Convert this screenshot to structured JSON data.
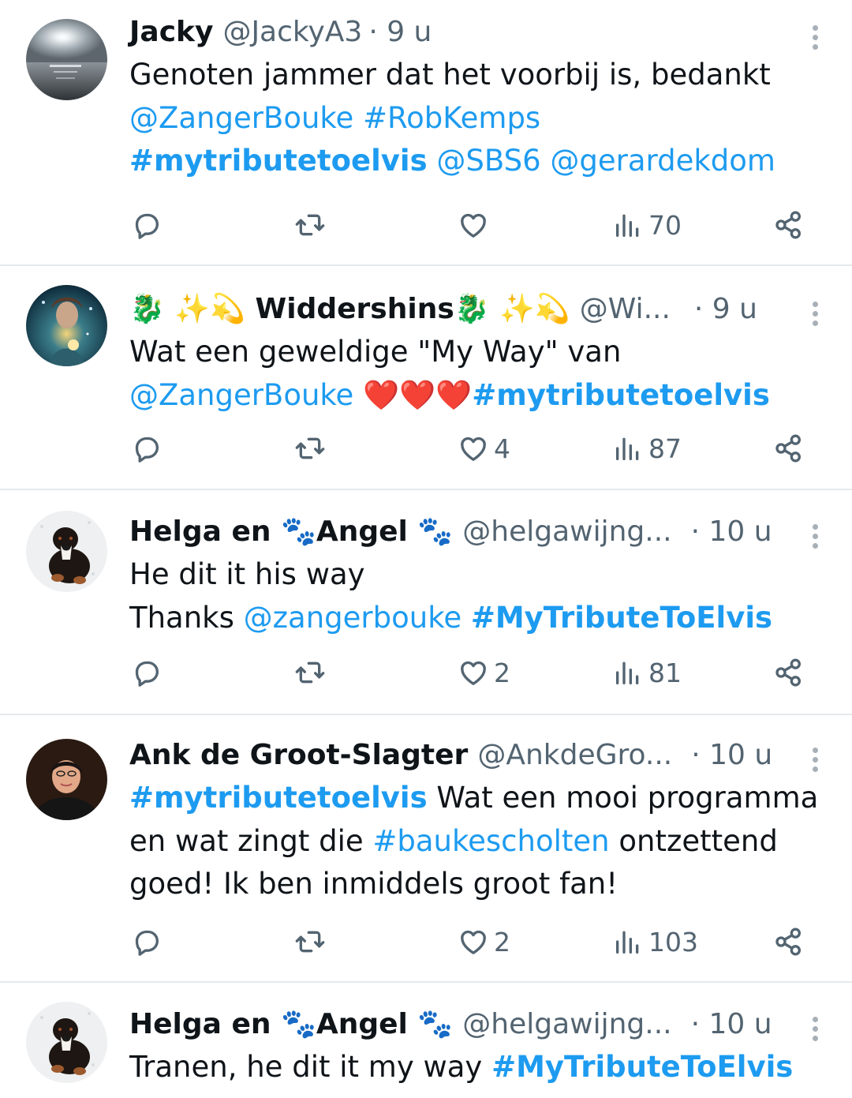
{
  "tweets": [
    {
      "name": "Jacky",
      "handle": "@JackyA3",
      "time": "· 9 u",
      "text_lines": [
        [
          {
            "t": "Genoten jammer dat het voorbij is, bedankt",
            "k": "plain"
          }
        ],
        [
          {
            "t": "@ZangerBouke",
            "k": "link"
          },
          {
            "t": " ",
            "k": "plain"
          },
          {
            "t": "#RobKemps",
            "k": "link"
          }
        ],
        [
          {
            "t": "#mytributetoelvis",
            "k": "linkbold"
          },
          {
            "t": " ",
            "k": "plain"
          },
          {
            "t": "@SBS6",
            "k": "link"
          },
          {
            "t": " ",
            "k": "plain"
          },
          {
            "t": "@gerardekdom",
            "k": "link"
          }
        ]
      ],
      "likes": "",
      "views": "70",
      "avatar": "sea"
    },
    {
      "name": "🐉 ✨💫 Widdershins🐉 ✨💫",
      "handle": "@Wi...",
      "time": "· 9 u",
      "text_lines": [
        [
          {
            "t": "Wat een geweldige \"My Way\" van",
            "k": "plain"
          }
        ],
        [
          {
            "t": "@ZangerBouke",
            "k": "link"
          },
          {
            "t": " ",
            "k": "plain"
          },
          {
            "t": "❤️❤️❤️",
            "k": "emoji"
          },
          {
            "t": "#mytributetoelvis",
            "k": "linkbold"
          }
        ]
      ],
      "likes": "4",
      "views": "87",
      "avatar": "fantasy"
    },
    {
      "name": "Helga en 🐾Angel 🐾",
      "handle": "@helgawijng...",
      "time": "· 10 u",
      "text_lines": [
        [
          {
            "t": "He dit it his way",
            "k": "plain"
          }
        ],
        [
          {
            "t": "Thanks ",
            "k": "plain"
          },
          {
            "t": "@zangerbouke",
            "k": "link"
          },
          {
            "t": " ",
            "k": "plain"
          },
          {
            "t": "#MyTributeToElvis",
            "k": "linkbold"
          }
        ]
      ],
      "likes": "2",
      "views": "81",
      "avatar": "dog"
    },
    {
      "name": "Ank de Groot-Slagter",
      "handle": "@AnkdeGro...",
      "time": "· 10 u",
      "text_lines": [
        [
          {
            "t": "#mytributetoelvis",
            "k": "linkbold"
          },
          {
            "t": " Wat een mooi programma",
            "k": "plain"
          }
        ],
        [
          {
            "t": "en wat zingt die ",
            "k": "plain"
          },
          {
            "t": "#baukescholten",
            "k": "link"
          },
          {
            "t": " ontzettend",
            "k": "plain"
          }
        ],
        [
          {
            "t": "goed! Ik ben inmiddels groot fan!",
            "k": "plain"
          }
        ]
      ],
      "likes": "2",
      "views": "103",
      "avatar": "woman"
    },
    {
      "name": "Helga en 🐾Angel 🐾",
      "handle": "@helgawijng...",
      "time": "· 10 u",
      "text_lines": [
        [
          {
            "t": "Tranen, he dit it my way  ",
            "k": "plain"
          },
          {
            "t": "#MyTributeToElvis",
            "k": "linkbold"
          }
        ]
      ],
      "likes": "",
      "views": "",
      "avatar": "dog"
    }
  ],
  "colors": {
    "link": "#1d9bf0",
    "muted": "#536471",
    "divider": "#e6e9ec",
    "heart_emoji": "#f2386b"
  },
  "icons": {
    "reply": "reply-icon",
    "retweet": "retweet-icon",
    "like": "heart-icon",
    "views": "views-icon",
    "share": "share-icon",
    "more": "more-vertical-icon"
  }
}
